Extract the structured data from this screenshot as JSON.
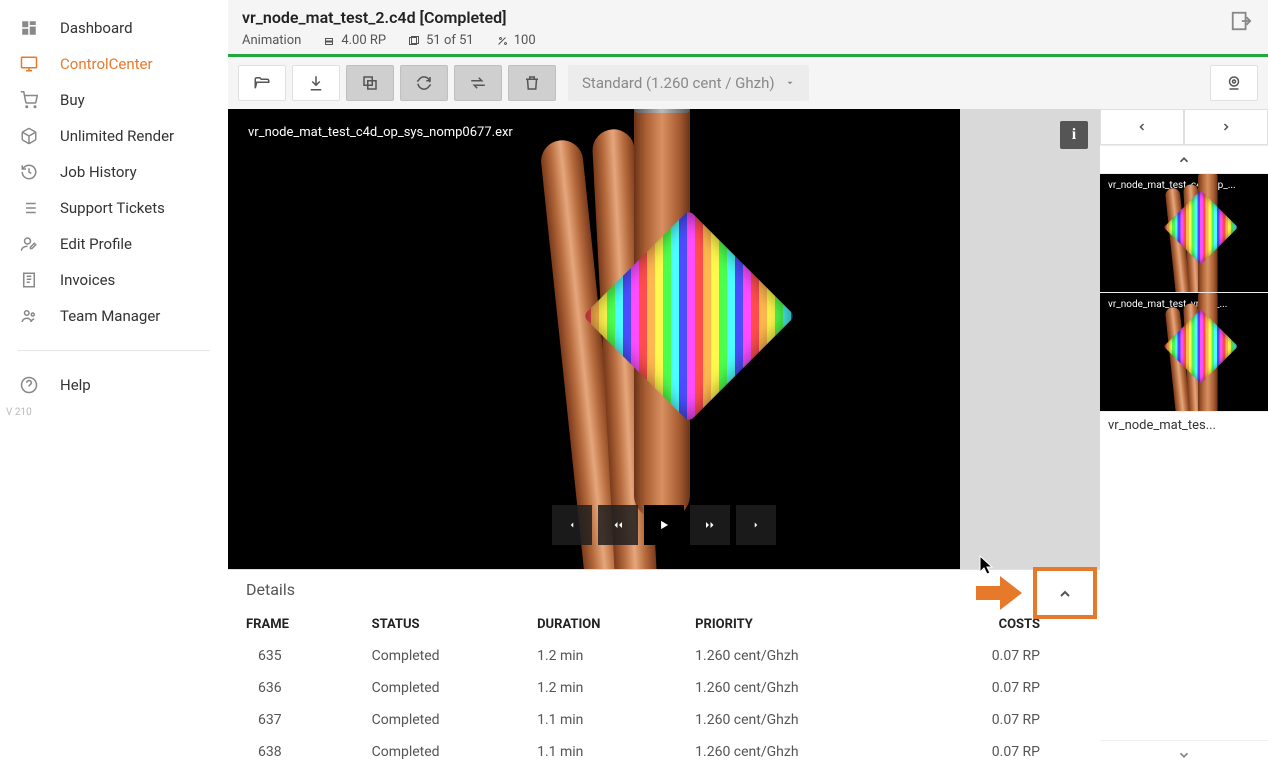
{
  "sidebar": {
    "items": [
      {
        "label": "Dashboard",
        "icon": "dashboard",
        "active": false
      },
      {
        "label": "ControlCenter",
        "icon": "monitor",
        "active": true
      },
      {
        "label": "Buy",
        "icon": "cart",
        "active": false
      },
      {
        "label": "Unlimited Render",
        "icon": "box",
        "active": false
      },
      {
        "label": "Job History",
        "icon": "history",
        "active": false
      },
      {
        "label": "Support Tickets",
        "icon": "list",
        "active": false
      },
      {
        "label": "Edit Profile",
        "icon": "user-edit",
        "active": false
      },
      {
        "label": "Invoices",
        "icon": "receipt",
        "active": false
      },
      {
        "label": "Team Manager",
        "icon": "team",
        "active": false
      }
    ],
    "help_label": "Help",
    "version": "V 210"
  },
  "header": {
    "title": "vr_node_mat_test_2.c4d [Completed]",
    "type_label": "Animation",
    "rp_value": "4.00 RP",
    "frames_value": "51 of 51",
    "percent_value": "100"
  },
  "toolbar": {
    "dropdown_label": "Standard (1.260 cent / Ghzh)"
  },
  "preview": {
    "filename": "vr_node_mat_test_c4d_op_sys_nomp0677.exr"
  },
  "details": {
    "title": "Details",
    "columns": [
      "FRAME",
      "STATUS",
      "DURATION",
      "PRIORITY",
      "COSTS"
    ],
    "rows": [
      {
        "frame": "635",
        "status": "Completed",
        "duration": "1.2 min",
        "priority": "1.260 cent/Ghzh",
        "costs": "0.07 RP"
      },
      {
        "frame": "636",
        "status": "Completed",
        "duration": "1.2 min",
        "priority": "1.260 cent/Ghzh",
        "costs": "0.07 RP"
      },
      {
        "frame": "637",
        "status": "Completed",
        "duration": "1.1 min",
        "priority": "1.260 cent/Ghzh",
        "costs": "0.07 RP"
      },
      {
        "frame": "638",
        "status": "Completed",
        "duration": "1.1 min",
        "priority": "1.260 cent/Ghzh",
        "costs": "0.07 RP"
      }
    ]
  },
  "thumbs": {
    "items": [
      {
        "label": "vr_node_mat_test_c4d_op_..."
      },
      {
        "label": "vr_node_mat_test_vr_op_..."
      }
    ],
    "caption": "vr_node_mat_tes..."
  }
}
